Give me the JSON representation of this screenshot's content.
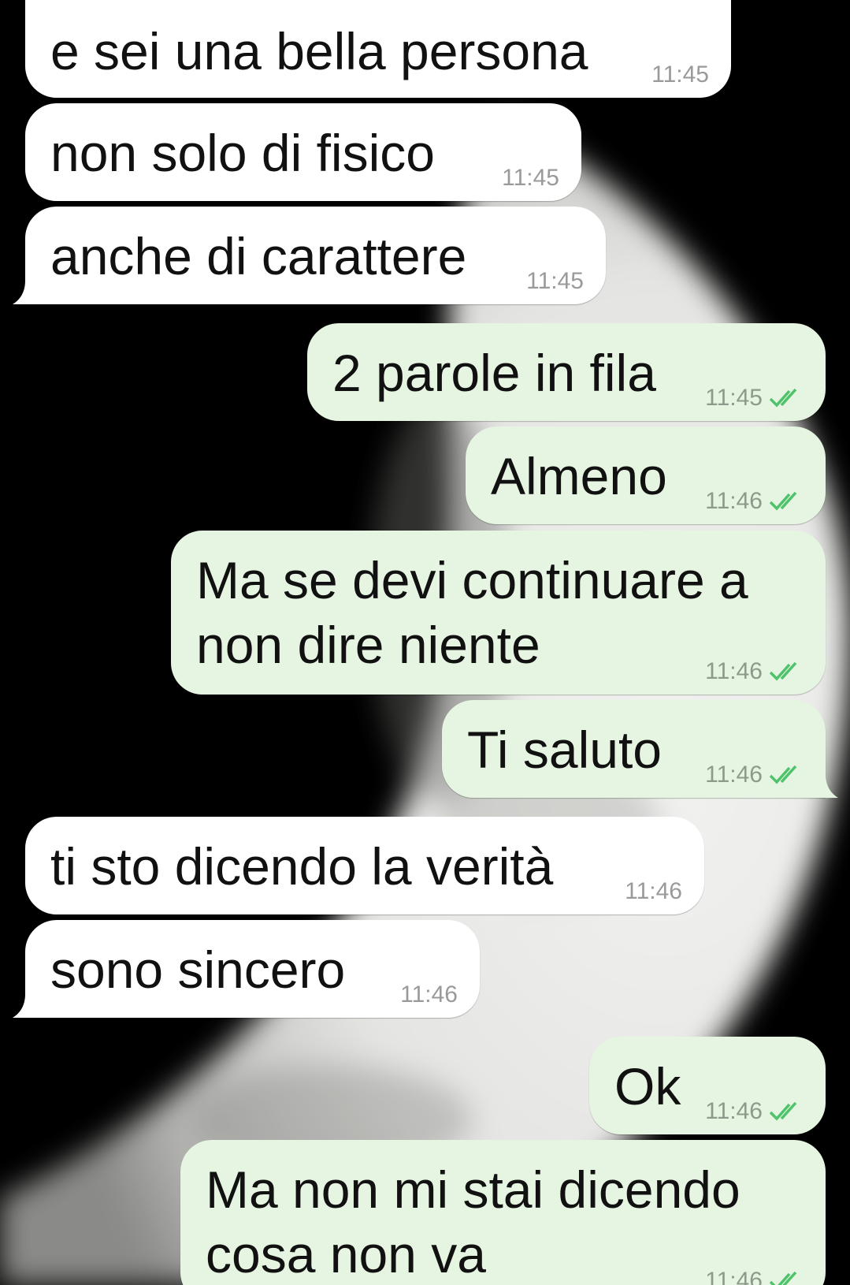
{
  "chat": {
    "messages": [
      {
        "direction": "incoming",
        "text": "e sei una bella persona",
        "time": "11:45"
      },
      {
        "direction": "incoming",
        "text": "non solo di fisico",
        "time": "11:45"
      },
      {
        "direction": "incoming",
        "text": "anche di carattere",
        "time": "11:45"
      },
      {
        "direction": "outgoing",
        "text": "2 parole in fila",
        "time": "11:45",
        "status": "read"
      },
      {
        "direction": "outgoing",
        "text": "Almeno",
        "time": "11:46",
        "status": "read"
      },
      {
        "direction": "outgoing",
        "text_line1": "Ma se devi continuare a",
        "text_line2": "non dire niente",
        "time": "11:46",
        "status": "read"
      },
      {
        "direction": "outgoing",
        "text": "Ti saluto",
        "time": "11:46",
        "status": "read"
      },
      {
        "direction": "incoming",
        "text": "ti sto dicendo la verità",
        "time": "11:46"
      },
      {
        "direction": "incoming",
        "text": "sono sincero",
        "time": "11:46"
      },
      {
        "direction": "outgoing",
        "text": "Ok",
        "time": "11:46",
        "status": "read"
      },
      {
        "direction": "outgoing",
        "text_line1": "Ma non mi stai dicendo",
        "text_line2": "cosa non va",
        "time": "11:46",
        "status": "read"
      }
    ]
  },
  "colors": {
    "incoming_bubble": "#ffffff",
    "outgoing_bubble": "#e6f4e2",
    "read_tick": "#4fc36b",
    "wallpaper": "#000000"
  },
  "icons": {
    "read_receipt": "double-check-icon"
  }
}
